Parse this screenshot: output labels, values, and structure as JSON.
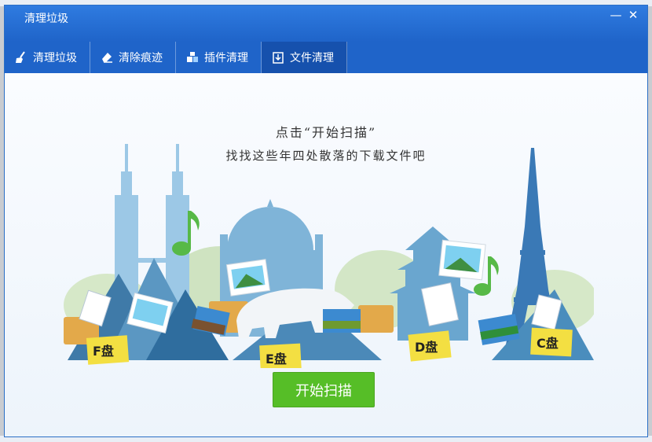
{
  "window": {
    "title": "清理垃圾",
    "minimize_symbol": "—",
    "close_symbol": "✕"
  },
  "tabs": [
    {
      "label": "清理垃圾",
      "icon": "broom-icon"
    },
    {
      "label": "清除痕迹",
      "icon": "eraser-icon"
    },
    {
      "label": "插件清理",
      "icon": "puzzle-icon"
    },
    {
      "label": "文件清理",
      "icon": "download-box-icon",
      "active": true
    }
  ],
  "main": {
    "line1": "点击“开始扫描”",
    "line2": "找找这些年四处散落的下载文件吧",
    "drives": [
      "F盘",
      "E盘",
      "D盘",
      "C盘"
    ],
    "scan_button": "开始扫描"
  },
  "colors": {
    "titlebar": "#2f7be0",
    "tab_active": "#1651ad",
    "scan_button": "#56be27",
    "drive_card": "#f3df42"
  }
}
